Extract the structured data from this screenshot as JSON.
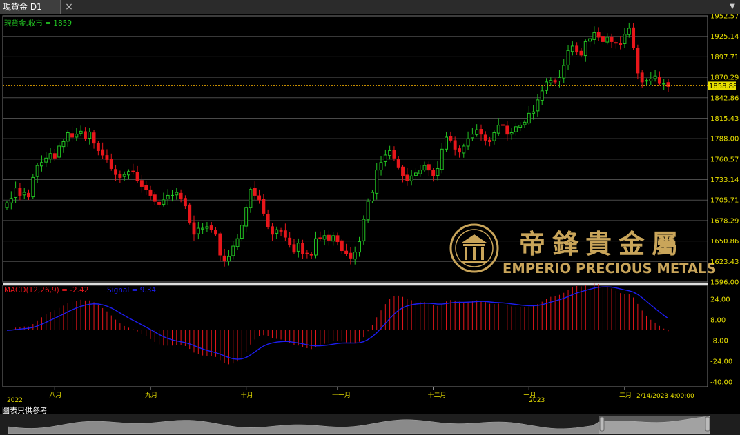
{
  "tab": {
    "title": "現貨金 D1",
    "close_icon": "close-icon"
  },
  "header": {
    "price_label": "現貨金.收市 = 1859"
  },
  "macd": {
    "label": "MACD(12,26,9) = -2.42",
    "signal": "Signal = 9.34"
  },
  "footer": {
    "note": "圖表只供參考",
    "date_label": "2/14/2023 4:00:00"
  },
  "watermark": {
    "cn": "帝鋒貴金屬",
    "en": "EMPERIO PRECIOUS METALS"
  },
  "current_price": "1858.88",
  "colors": {
    "up": "#22c322",
    "down": "#e8161b",
    "axis_text": "#e8e000",
    "grid": "#4a4a4a",
    "signal": "#1d1df0",
    "gold": "#c9a55a"
  },
  "chart_data": {
    "type": "candlestick",
    "price_axis": {
      "min": 1596.0,
      "max": 1952.57,
      "ticks": [
        "1952.57",
        "1925.14",
        "1897.71",
        "1870.29",
        "1842.86",
        "1815.43",
        "1788.00",
        "1760.57",
        "1733.14",
        "1705.71",
        "1678.29",
        "1650.86",
        "1623.43",
        "1596.00"
      ]
    },
    "macd_axis": {
      "min": -40,
      "max": 24,
      "ticks": [
        "24.00",
        "8.00",
        "-8.00",
        "-24.00",
        "-40.00"
      ]
    },
    "x_labels": [
      {
        "label": "2022",
        "i": 0,
        "row": 2
      },
      {
        "label": "八月",
        "i": 11,
        "row": 1
      },
      {
        "label": "九月",
        "i": 33,
        "row": 1
      },
      {
        "label": "十月",
        "i": 55,
        "row": 1
      },
      {
        "label": "十一月",
        "i": 76,
        "row": 1
      },
      {
        "label": "十二月",
        "i": 98,
        "row": 1
      },
      {
        "label": "一月",
        "i": 120,
        "row": 1
      },
      {
        "label": "2023",
        "i": 120,
        "row": 2
      },
      {
        "label": "二月",
        "i": 142,
        "row": 1
      }
    ],
    "closes": [
      1702,
      1708,
      1722,
      1712,
      1716,
      1710,
      1736,
      1752,
      1756,
      1762,
      1768,
      1762,
      1778,
      1784,
      1796,
      1790,
      1794,
      1798,
      1788,
      1797,
      1782,
      1772,
      1766,
      1760,
      1748,
      1740,
      1736,
      1740,
      1744,
      1744,
      1732,
      1724,
      1720,
      1712,
      1704,
      1700,
      1706,
      1712,
      1712,
      1716,
      1708,
      1698,
      1676,
      1660,
      1668,
      1668,
      1670,
      1666,
      1660,
      1632,
      1624,
      1630,
      1644,
      1654,
      1672,
      1696,
      1720,
      1712,
      1706,
      1688,
      1670,
      1660,
      1666,
      1664,
      1656,
      1646,
      1636,
      1648,
      1634,
      1634,
      1632,
      1654,
      1654,
      1658,
      1652,
      1658,
      1650,
      1638,
      1634,
      1628,
      1636,
      1650,
      1680,
      1704,
      1716,
      1746,
      1756,
      1766,
      1772,
      1762,
      1750,
      1738,
      1732,
      1738,
      1742,
      1746,
      1752,
      1746,
      1738,
      1748,
      1774,
      1790,
      1786,
      1774,
      1770,
      1778,
      1788,
      1794,
      1800,
      1794,
      1786,
      1784,
      1796,
      1806,
      1806,
      1794,
      1796,
      1804,
      1806,
      1810,
      1822,
      1824,
      1840,
      1852,
      1864,
      1866,
      1864,
      1870,
      1886,
      1906,
      1912,
      1904,
      1900,
      1918,
      1922,
      1930,
      1924,
      1918,
      1924,
      1918,
      1916,
      1914,
      1928,
      1936,
      1910,
      1876,
      1864,
      1866,
      1868,
      1872,
      1862,
      1862,
      1858
    ]
  }
}
